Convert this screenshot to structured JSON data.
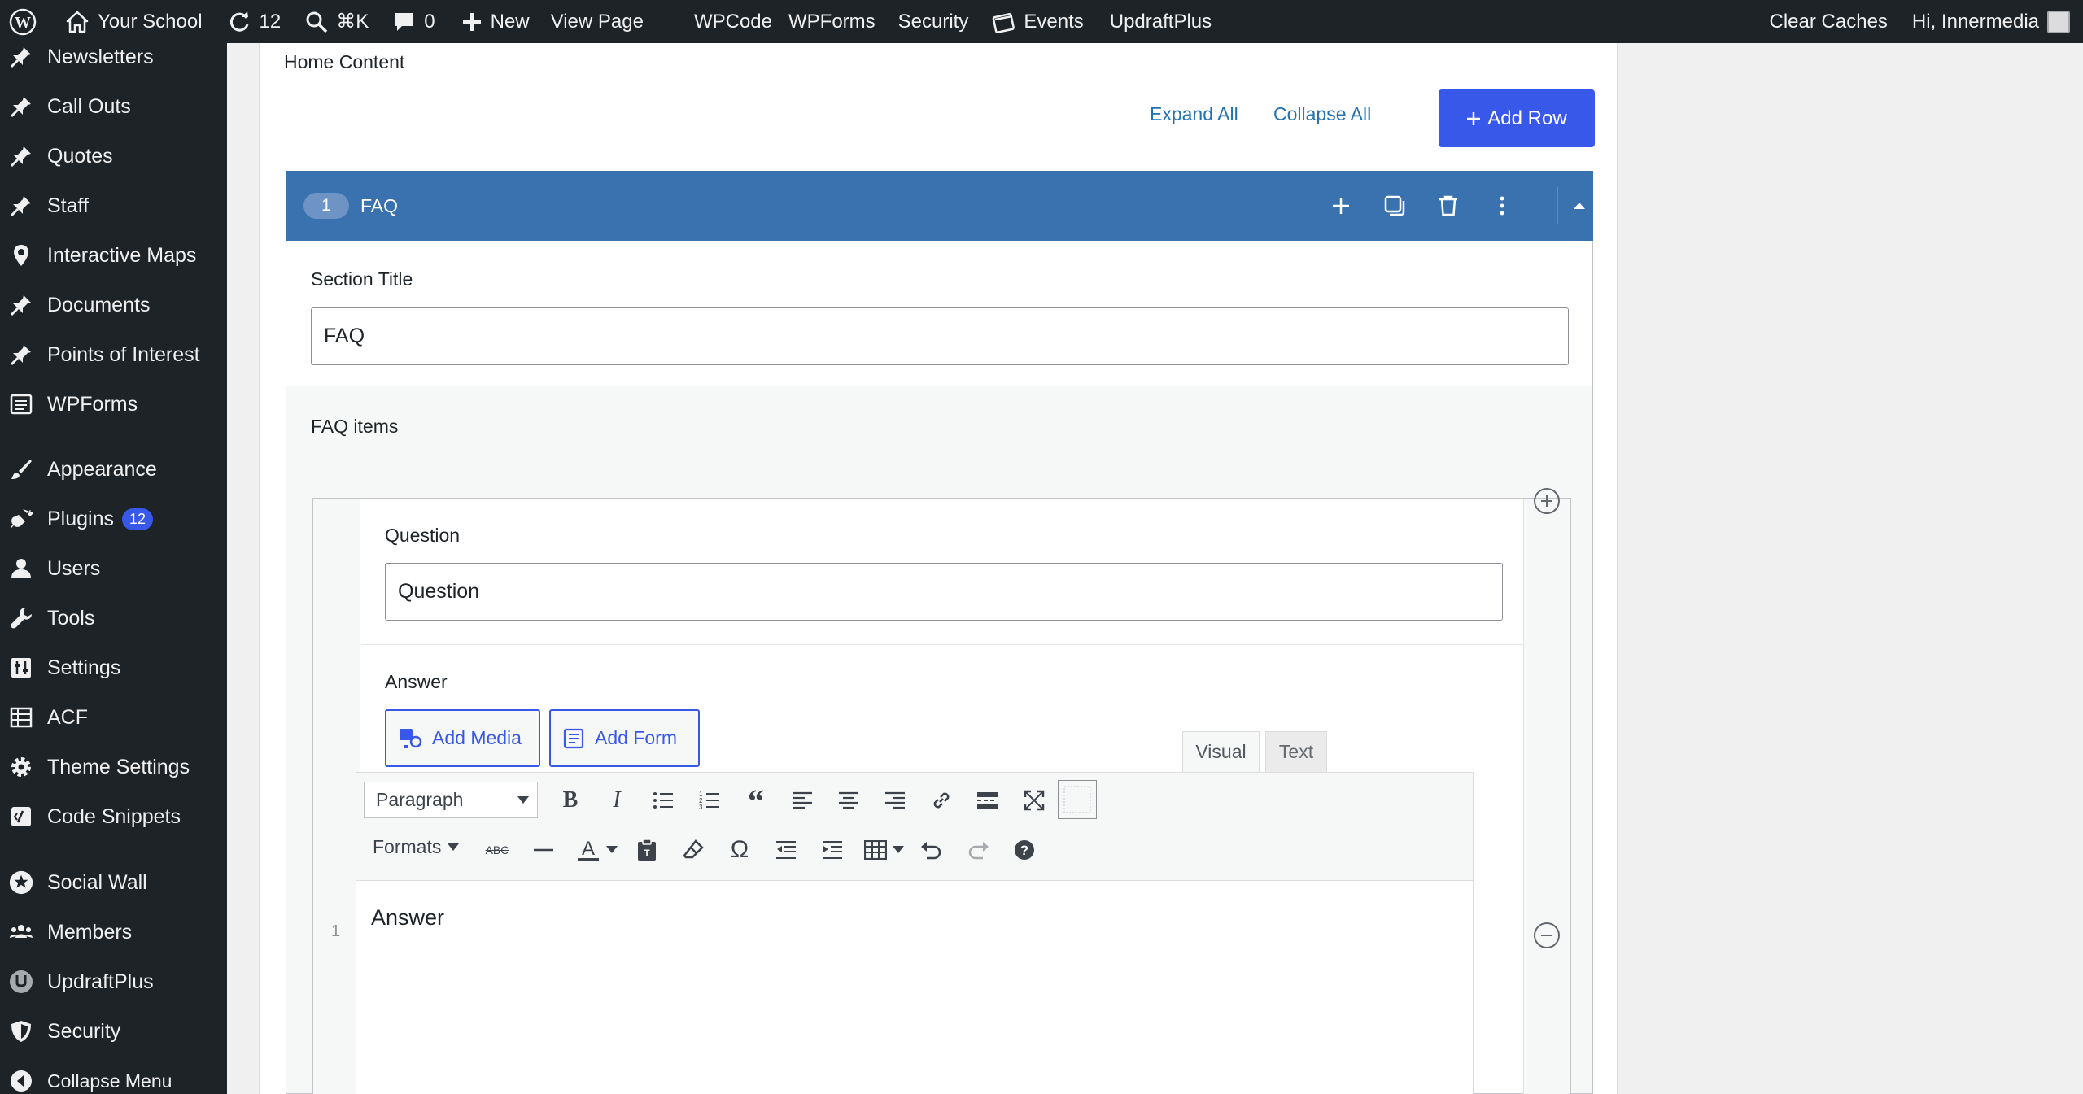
{
  "admin_bar": {
    "site_name": "Your School",
    "updates_count": "12",
    "search_shortcut": "⌘K",
    "comments_count": "0",
    "new_label": "New",
    "view_page": "View Page",
    "wpcode": "WPCode",
    "wpforms": "WPForms",
    "security": "Security",
    "events": "Events",
    "updraftplus": "UpdraftPlus",
    "clear_caches": "Clear Caches",
    "greeting": "Hi, Innermedia"
  },
  "sidebar": {
    "items": [
      {
        "label": "Newsletters",
        "icon": "pin-icon"
      },
      {
        "label": "Call Outs",
        "icon": "pin-icon"
      },
      {
        "label": "Quotes",
        "icon": "pin-icon"
      },
      {
        "label": "Staff",
        "icon": "pin-icon"
      },
      {
        "label": "Interactive Maps",
        "icon": "location-icon"
      },
      {
        "label": "Documents",
        "icon": "pin-icon"
      },
      {
        "label": "Points of Interest",
        "icon": "pin-icon"
      },
      {
        "label": "WPForms",
        "icon": "form-icon"
      },
      {
        "label": "Appearance",
        "icon": "brush-icon"
      },
      {
        "label": "Plugins",
        "icon": "plugin-icon",
        "badge": "12"
      },
      {
        "label": "Users",
        "icon": "user-icon"
      },
      {
        "label": "Tools",
        "icon": "wrench-icon"
      },
      {
        "label": "Settings",
        "icon": "settings-icon"
      },
      {
        "label": "ACF",
        "icon": "table-icon"
      },
      {
        "label": "Theme Settings",
        "icon": "gear-icon"
      },
      {
        "label": "Code Snippets",
        "icon": "code-icon"
      },
      {
        "label": "Social Wall",
        "icon": "social-icon"
      },
      {
        "label": "Members",
        "icon": "members-icon"
      },
      {
        "label": "UpdraftPlus",
        "icon": "updraft-icon"
      },
      {
        "label": "Security",
        "icon": "shield-icon"
      },
      {
        "label": "Collapse Menu",
        "icon": "collapse-icon"
      }
    ]
  },
  "content": {
    "heading": "Home Content",
    "expand_all": "Expand All",
    "collapse_all": "Collapse All",
    "add_row": "Add Row",
    "layout": {
      "number": "1",
      "title": "FAQ"
    },
    "section_title_label": "Section Title",
    "section_title_value": "FAQ",
    "faq_items_label": "FAQ items",
    "row_number": "1",
    "question_label": "Question",
    "question_value": "Question",
    "answer_label": "Answer",
    "add_media": "Add Media",
    "add_form": "Add Form",
    "tab_visual": "Visual",
    "tab_text": "Text",
    "format_select": "Paragraph",
    "formats_label": "Formats",
    "answer_value": "Answer"
  },
  "colors": {
    "adminbar_bg": "#1d2327",
    "accent": "#3858e9",
    "layout_header": "#3a72b0",
    "link": "#2271b1"
  }
}
